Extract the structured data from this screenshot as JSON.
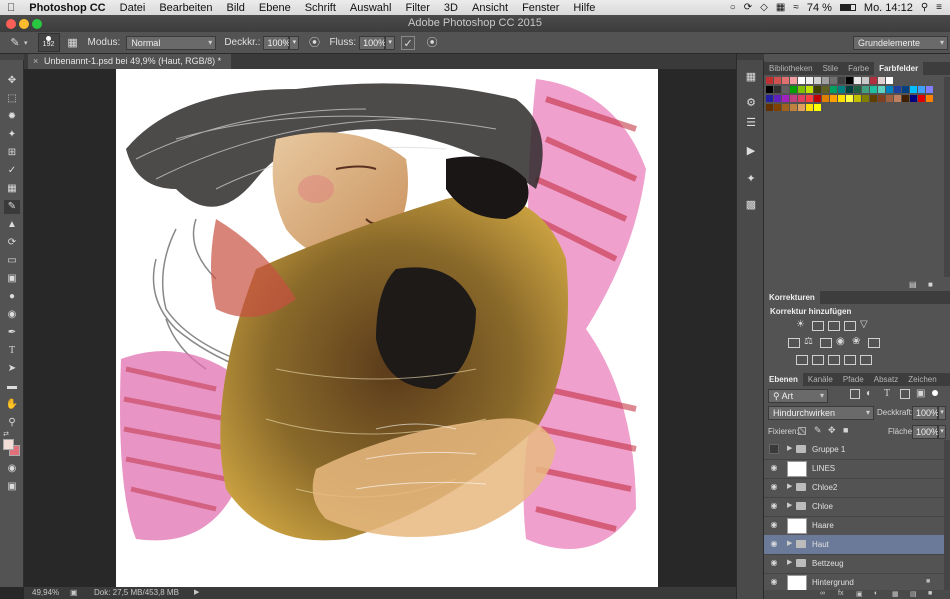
{
  "menubar": {
    "apple": "",
    "app_name": "Photoshop CC",
    "items": [
      "Datei",
      "Bearbeiten",
      "Bild",
      "Ebene",
      "Schrift",
      "Auswahl",
      "Filter",
      "3D",
      "Ansicht",
      "Fenster",
      "Hilfe"
    ],
    "battery": "74 %",
    "clock": "Mo. 14:12"
  },
  "window": {
    "title": "Adobe Photoshop CC 2015"
  },
  "options": {
    "brush_size": "192",
    "mode_label": "Modus:",
    "mode_value": "Normal",
    "opacity_label": "Deckkr.:",
    "opacity_value": "100%",
    "flow_label": "Fluss:",
    "flow_value": "100%",
    "workspace": "Grundelemente"
  },
  "document": {
    "tab_title": "Unbenannt-1.psd bei 49,9% (Haut, RGB/8) *",
    "close_symbol": "×",
    "zoom": "49,94%",
    "doc_size": "Dok: 27,5 MB/453,8 MB"
  },
  "colors": {
    "foreground": "#f2dcd6",
    "background": "#e0707a",
    "selection": "#6b7a99"
  },
  "swatches_panel": {
    "tabs": [
      "Bibliotheken",
      "Stile",
      "Farbe",
      "Farbfelder"
    ],
    "active_tab": "Farbfelder",
    "row1": [
      "#c03030",
      "#d05050",
      "#e07070",
      "#f0a0a0",
      "#ffffff",
      "#f0f0f0",
      "#d0d0d0",
      "#a0a0a0",
      "#707070",
      "#404040",
      "#000000",
      "#e8e8e8",
      "#c8c8c8",
      "#b03040",
      "#e0d0d0",
      "#ffffff"
    ],
    "row2": [
      "#000000",
      "#303030",
      "#606060",
      "#00a000",
      "#80c000",
      "#c0e000",
      "#404000",
      "#606020",
      "#00a060",
      "#008080",
      "#004040",
      "#206040",
      "#40a080",
      "#20c0a0",
      "#60d0c0",
      "#0080c0",
      "#2040a0",
      "#004080",
      "#00c0ff",
      "#40a0ff",
      "#8080ff"
    ],
    "row3": [
      "#2020a0",
      "#6020c0",
      "#a020c0",
      "#c04080",
      "#e04060",
      "#ff4040",
      "#c00000",
      "#e08000",
      "#ffa000",
      "#ffe000",
      "#ffff40",
      "#c0c000",
      "#808000",
      "#604000",
      "#804020",
      "#a06040",
      "#c08060",
      "#402000",
      "#000080",
      "#e00000",
      "#ff8000"
    ],
    "row4": [
      "#603000",
      "#804000",
      "#a06020",
      "#c08040",
      "#e0a060",
      "#ffe000",
      "#ffff00"
    ]
  },
  "adjustments_panel": {
    "title": "Korrekturen",
    "subtitle": "Korrektur hinzufügen"
  },
  "layers_panel": {
    "tabs": [
      "Ebenen",
      "Kanäle",
      "Pfade",
      "Absatz",
      "Zeichen"
    ],
    "active_tab": "Ebenen",
    "filter_kind": "Art",
    "blend_mode": "Hindurchwirken",
    "opacity_label": "Deckkraft:",
    "opacity_value": "100%",
    "lock_label": "Fixieren:",
    "fill_label": "Fläche:",
    "fill_value": "100%",
    "layers": [
      {
        "name": "Gruppe 1",
        "kind": "group",
        "visible": false,
        "selected": false
      },
      {
        "name": "LINES",
        "kind": "layer",
        "visible": true,
        "selected": false
      },
      {
        "name": "Chloe2",
        "kind": "group",
        "visible": true,
        "selected": false
      },
      {
        "name": "Chloe",
        "kind": "group",
        "visible": true,
        "selected": false
      },
      {
        "name": "Haare",
        "kind": "layer",
        "visible": true,
        "selected": false
      },
      {
        "name": "Haut",
        "kind": "group",
        "visible": true,
        "selected": true
      },
      {
        "name": "Bettzeug",
        "kind": "group",
        "visible": true,
        "selected": false
      },
      {
        "name": "Hintergrund",
        "kind": "layer",
        "visible": true,
        "selected": false
      }
    ]
  }
}
